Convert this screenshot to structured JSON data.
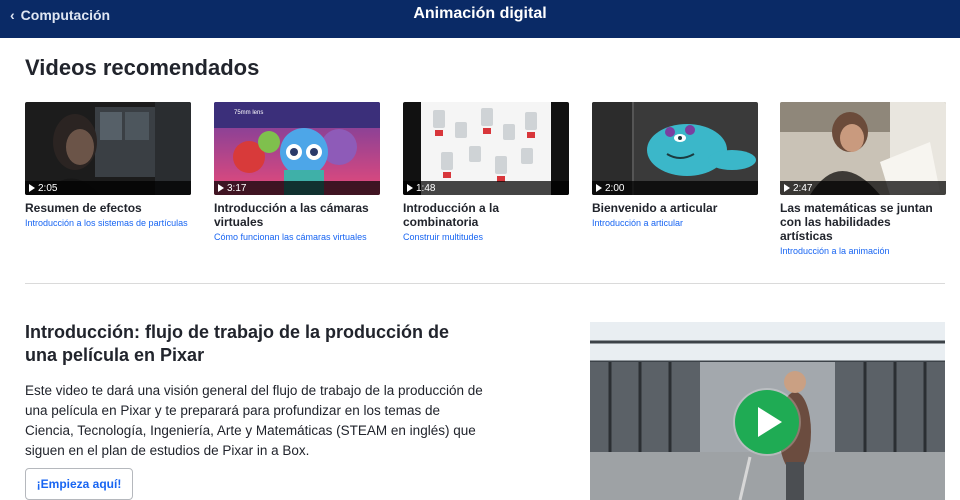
{
  "header": {
    "back_label": "Computación",
    "title": "Animación digital"
  },
  "recommended": {
    "title": "Videos recomendados",
    "videos": [
      {
        "duration": "2:05",
        "title": "Resumen de efectos",
        "subtitle": "Introducción a los sistemas de partículas"
      },
      {
        "duration": "3:17",
        "title": "Introducción a las cámaras virtuales",
        "subtitle": "Cómo funcionan las cámaras virtuales",
        "thumb_text": "75mm lens"
      },
      {
        "duration": "1:48",
        "title": "Introducción a la combinatoria",
        "subtitle": "Construir multitudes"
      },
      {
        "duration": "2:00",
        "title": "Bienvenido a articular",
        "subtitle": "Introducción a articular"
      },
      {
        "duration": "2:47",
        "title": "Las matemáticas se juntan con las habilidades artísticas",
        "subtitle": "Introducción a la animación"
      }
    ]
  },
  "intro": {
    "title": "Introducción: flujo de trabajo de la producción de una película en Pixar",
    "description": "Este video te dará una visión general del flujo de trabajo de la producción de una película en Pixar y te preparará para profundizar en los temas de Ciencia, Tecnología, Ingeniería, Arte y Matemáticas (STEAM en inglés) que siguen en el plan de estudios de Pixar in a Box.",
    "start_label": "¡Empieza aquí!"
  },
  "colors": {
    "header_bg": "#0a2a66",
    "link": "#1865f2",
    "play_green": "#1fab54"
  }
}
